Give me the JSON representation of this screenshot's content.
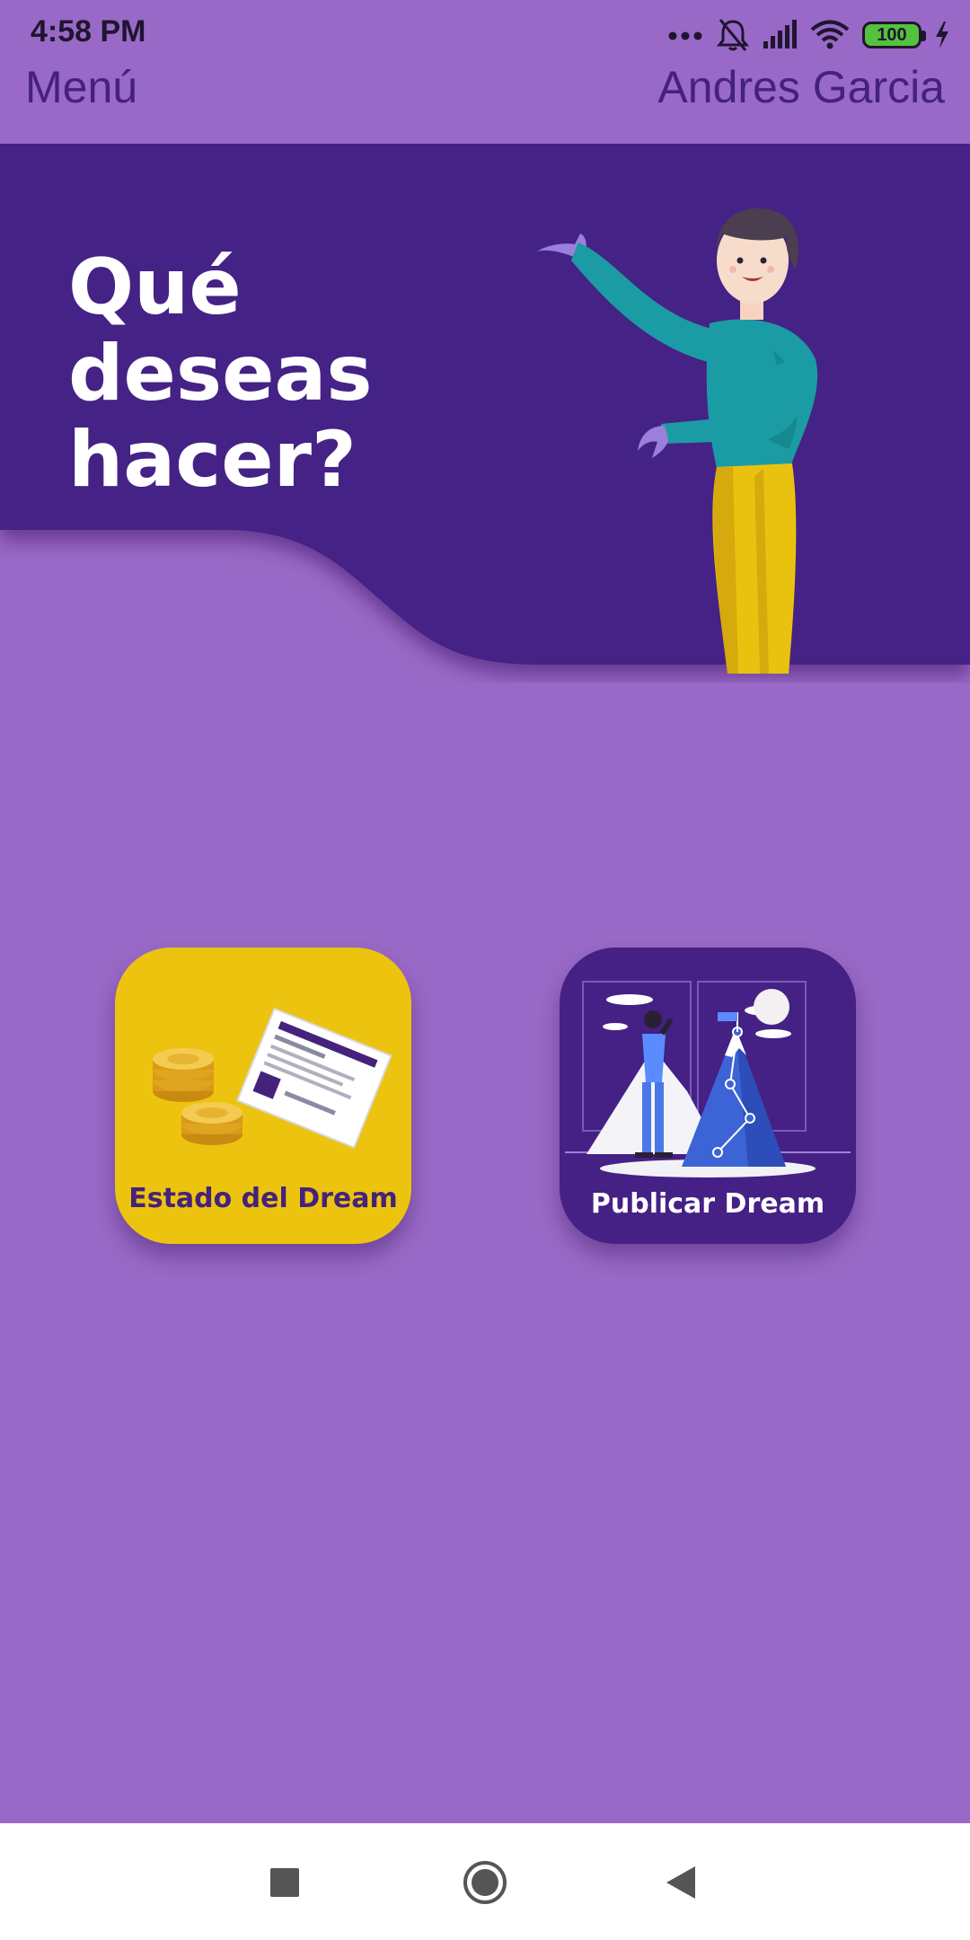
{
  "status_bar": {
    "time": "4:58 PM",
    "battery": "100",
    "icons": [
      "more-dots-icon",
      "bell-off-icon",
      "signal-icon",
      "wifi-icon",
      "battery-icon",
      "charging-icon"
    ]
  },
  "header": {
    "menu_label": "Menú",
    "user_name": "Andres Garcia"
  },
  "hero": {
    "title": "Qué deseas hacer?"
  },
  "cards": [
    {
      "label": "Estado del Dream",
      "icon": "coins-receipt-illustration"
    },
    {
      "label": "Publicar Dream",
      "icon": "mountain-explorer-illustration"
    }
  ],
  "nav": {
    "buttons": [
      "recents-button",
      "home-button",
      "back-button"
    ]
  },
  "colors": {
    "background": "#9869c6",
    "hero": "#452085",
    "accent_yellow": "#ecc30f",
    "header_text": "#46207f"
  }
}
